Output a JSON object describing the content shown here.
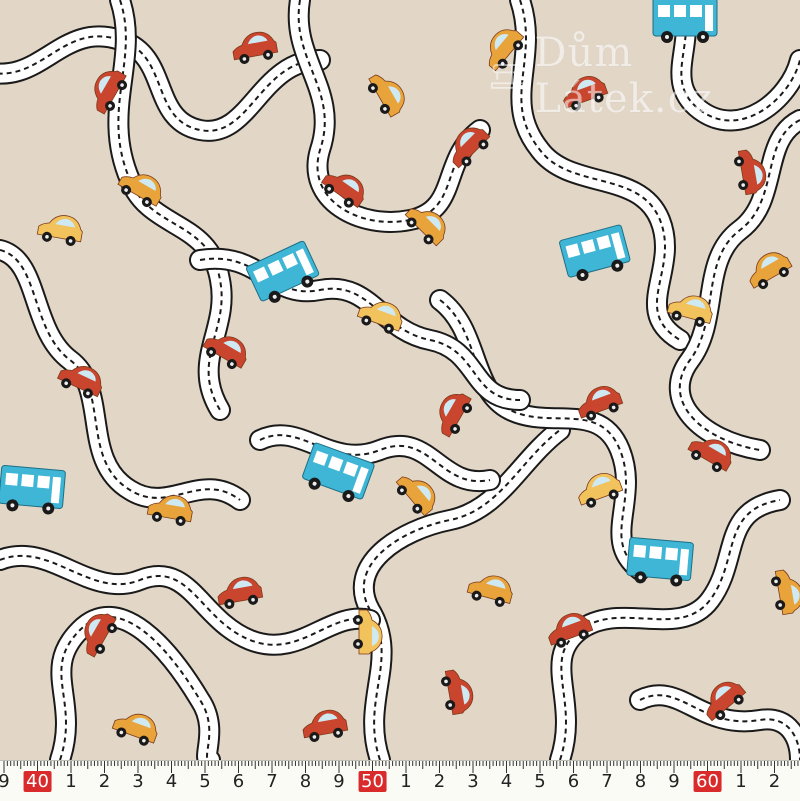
{
  "scene": {
    "description_free": true,
    "background_color": "#e2d6c6",
    "road_color": "#ffffff",
    "road_edge_color": "#1a1a1a",
    "car_colors": [
      "#c9452e",
      "#e8a43b",
      "#f2c25c",
      "#3fb6d6"
    ]
  },
  "watermark": {
    "text": "Dům Látek.cz",
    "icon": "sewing-machine-icon"
  },
  "ruler": {
    "labels": [
      "9",
      "40",
      "1",
      "2",
      "3",
      "4",
      "5",
      "6",
      "7",
      "8",
      "9",
      "50",
      "1",
      "2",
      "3",
      "4",
      "5",
      "6",
      "7",
      "8",
      "9",
      "60",
      "1",
      "2"
    ],
    "highlighted": [
      "40",
      "50",
      "60"
    ],
    "highlight_color": "#d92b2b"
  }
}
